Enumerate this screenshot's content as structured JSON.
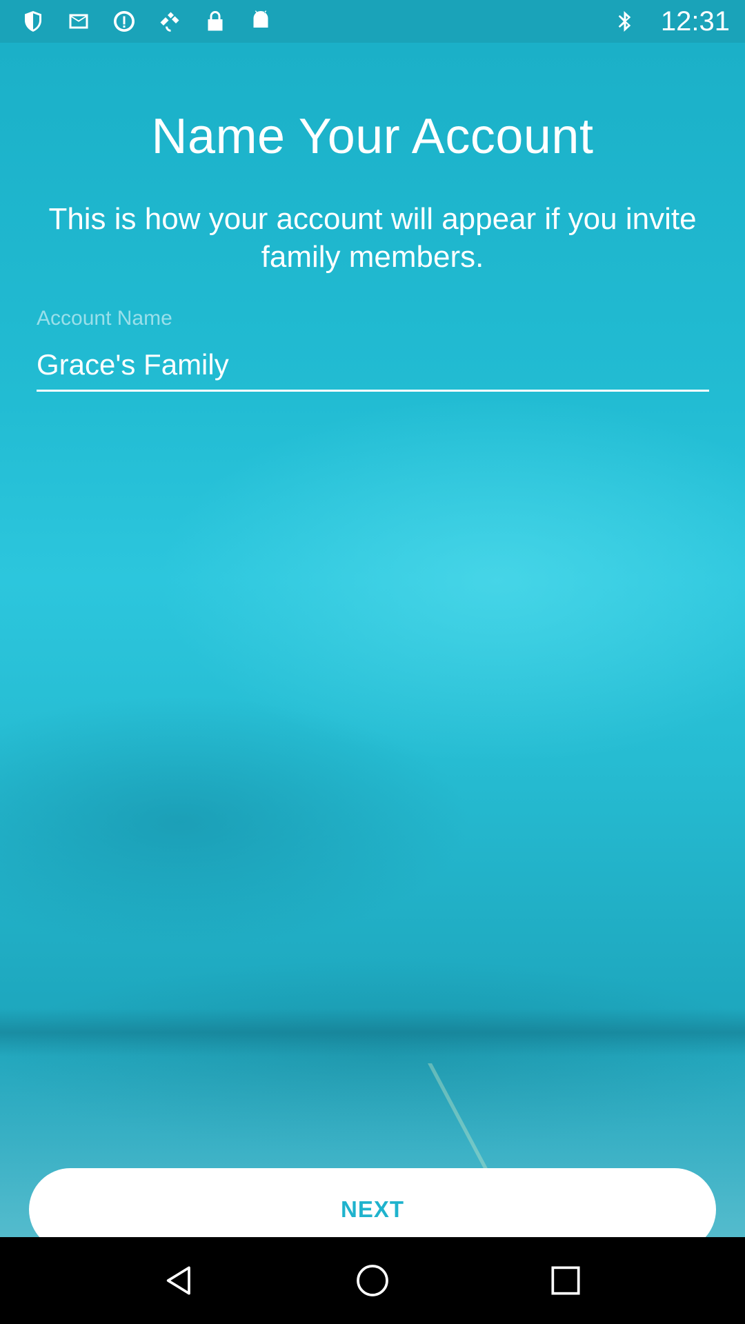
{
  "status_bar": {
    "time": "12:31",
    "icons_left": [
      "shield-icon",
      "mail-icon",
      "data-saver-icon",
      "fake-gps-icon",
      "lock-icon",
      "android-icon"
    ],
    "icons_right": [
      "bluetooth-icon"
    ]
  },
  "main": {
    "title": "Name Your Account",
    "subtitle": "This is how your account will appear if you invite family members.",
    "account_name": {
      "label": "Account Name",
      "value": "Grace's Family"
    },
    "next_label": "NEXT"
  },
  "colors": {
    "accent": "#1fb3cd",
    "background": "#22bcd3",
    "text": "#ffffff"
  },
  "nav_bar": {
    "icons": [
      "back-icon",
      "home-icon",
      "recents-icon"
    ]
  }
}
